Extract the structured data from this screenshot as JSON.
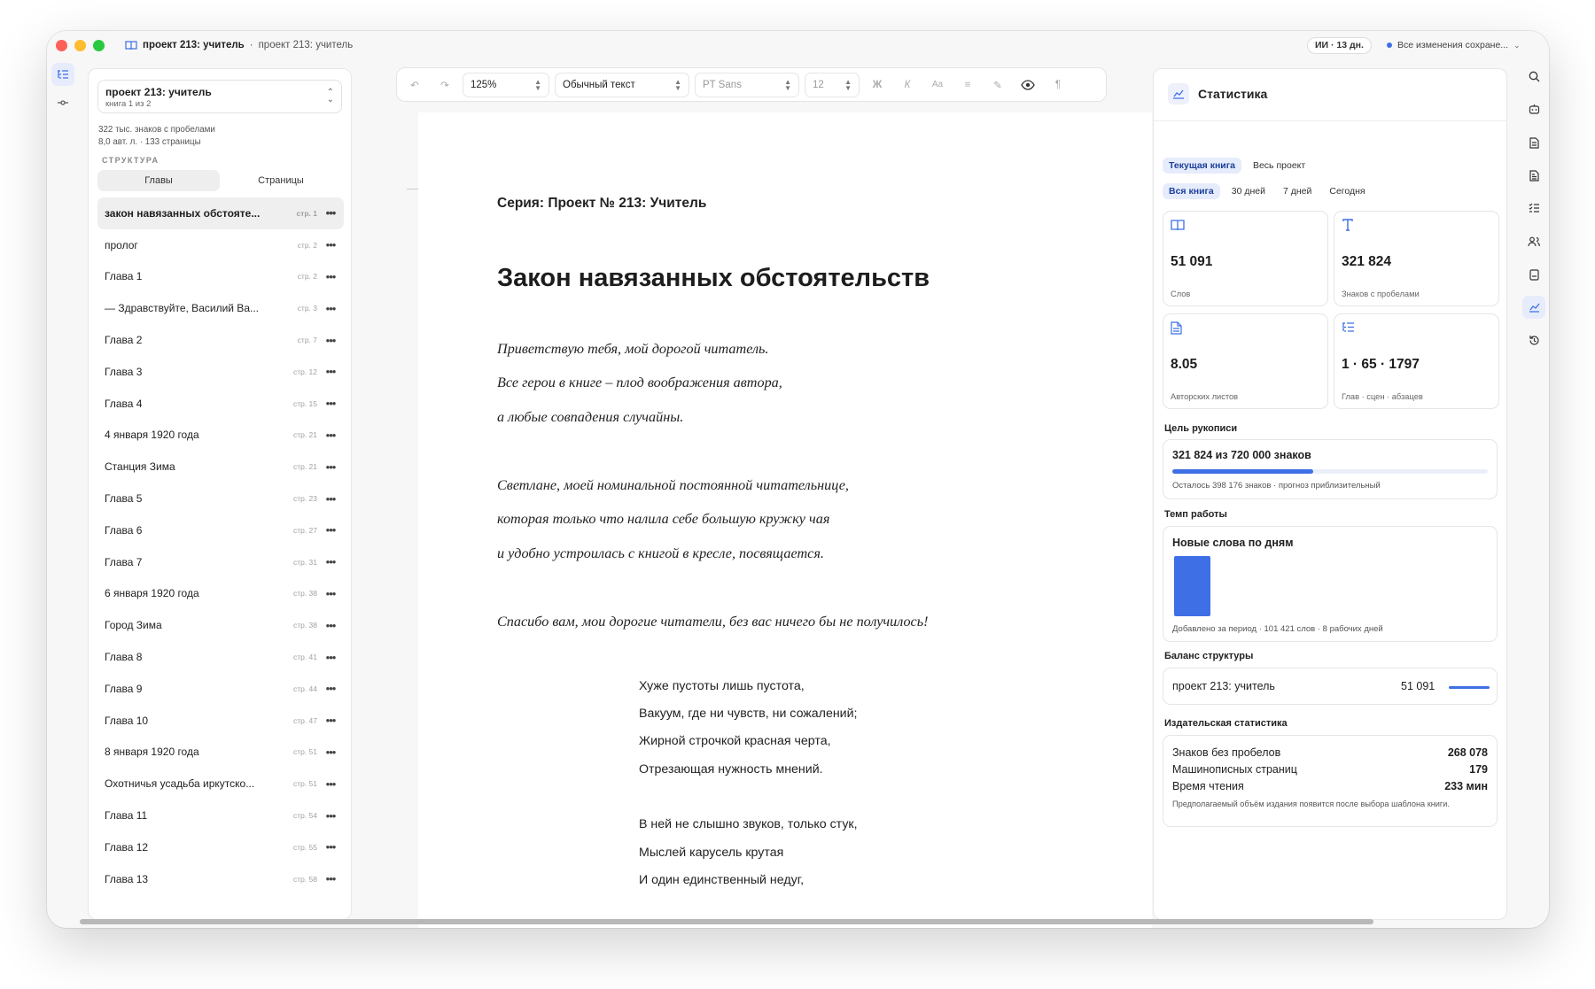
{
  "window": {
    "title_bold": "проект 213: учитель",
    "title_sep": "·",
    "title_sub": "проект 213: учитель",
    "ai_badge": "ИИ · 13 дн.",
    "saved_status": "Все изменения сохране..."
  },
  "sidebar": {
    "project_name": "проект 213: учитель",
    "project_sub": "книга 1 из 2",
    "meta_line1": "322 тыс. знаков с пробелами",
    "meta_line2": "8,0 авт. л. · 133 страницы",
    "structure_label": "СТРУКТУРА",
    "seg_chapters": "Главы",
    "seg_pages": "Страницы",
    "items": [
      {
        "label": "закон навязанных обстояте...",
        "page": "стр. 1"
      },
      {
        "label": "пролог",
        "page": "стр. 2"
      },
      {
        "label": "Глава 1",
        "page": "стр. 2"
      },
      {
        "label": "— Здравствуйте, Василий Ва...",
        "page": "стр. 3"
      },
      {
        "label": "Глава 2",
        "page": "стр. 7"
      },
      {
        "label": "Глава 3",
        "page": "стр. 12"
      },
      {
        "label": "Глава 4",
        "page": "стр. 15"
      },
      {
        "label": "4 января 1920 года",
        "page": "стр. 21"
      },
      {
        "label": "Станция Зима",
        "page": "стр. 21"
      },
      {
        "label": "Глава 5",
        "page": "стр. 23"
      },
      {
        "label": "Глава 6",
        "page": "стр. 27"
      },
      {
        "label": "Глава 7",
        "page": "стр. 31"
      },
      {
        "label": "6 января 1920 года",
        "page": "стр. 38"
      },
      {
        "label": "Город Зима",
        "page": "стр. 38"
      },
      {
        "label": "Глава 8",
        "page": "стр. 41"
      },
      {
        "label": "Глава 9",
        "page": "стр. 44"
      },
      {
        "label": "Глава 10",
        "page": "стр. 47"
      },
      {
        "label": "8 января 1920 года",
        "page": "стр. 51"
      },
      {
        "label": "Охотничья усадьба иркутско...",
        "page": "стр. 51"
      },
      {
        "label": "Глава 11",
        "page": "стр. 54"
      },
      {
        "label": "Глава 12",
        "page": "стр. 55"
      },
      {
        "label": "Глава 13",
        "page": "стр. 58"
      }
    ]
  },
  "toolbar": {
    "zoom": "125%",
    "style": "Обычный текст",
    "font": "PT Sans",
    "size": "12",
    "bold": "Ж",
    "italic": "К",
    "case": "Aa"
  },
  "document": {
    "series": "Серия: Проект № 213: Учитель",
    "title": "Закон навязанных обстоятельств",
    "italic_lines": [
      "Приветствую тебя, мой дорогой читатель.",
      "Все герои в книге – плод воображения автора,",
      "а любые совпадения случайны.",
      "Светлане, моей номинальной постоянной читательнице,",
      "которая только что налила себе большую кружку чая",
      "и удобно устроилась с книгой в кресле, посвящается.",
      "Спасибо вам, мои дорогие читатели, без вас ничего бы не получилось!"
    ],
    "poem_lines": [
      "Хуже пустоты лишь пустота,",
      "Вакуум, где ни чувств, ни сожалений;",
      "Жирной строчкой красная черта,",
      "Отрезающая нужность мнений.",
      "В ней не слышно звуков, только стук,",
      "Мыслей карусель крутая",
      "И один единственный недуг,"
    ]
  },
  "stats": {
    "title": "Статистика",
    "scope_tabs": [
      "Текущая книга",
      "Весь проект"
    ],
    "period_tabs": [
      "Вся книга",
      "30 дней",
      "7 дней",
      "Сегодня"
    ],
    "cards": [
      {
        "icon": "book-icon",
        "value": "51 091",
        "label": "Слов"
      },
      {
        "icon": "text-icon",
        "value": "321 824",
        "label": "Знаков с пробелами"
      },
      {
        "icon": "document-icon",
        "value": "8.05",
        "label": "Авторских листов"
      },
      {
        "icon": "list-icon",
        "value": "1 · 65 · 1797",
        "label": "Глав · сцен · абзацев"
      }
    ],
    "goal_header": "Цель рукописи",
    "goal_value": "321 824 из 720 000 знаков",
    "goal_progress": 0.447,
    "goal_note": "Осталось 398 176 знаков · прогноз приблизительный",
    "tempo_header": "Темп работы",
    "tempo_title": "Новые слова по дням",
    "tempo_note": "Добавлено за период · 101 421 слов · 8 рабочих дней",
    "balance_header": "Баланс структуры",
    "balance_label": "проект 213: учитель",
    "balance_value": "51 091",
    "pub_header": "Издательская статистика",
    "pub_rows": [
      {
        "label": "Знаков без пробелов",
        "value": "268 078"
      },
      {
        "label": "Машинописных страниц",
        "value": "179"
      },
      {
        "label": "Время чтения",
        "value": "233 мин"
      }
    ],
    "pub_note": "Предполагаемый объём издания появится после выбора шаблона книги."
  },
  "colors": {
    "accent": "#3f6fe5",
    "tab_active_bg": "#e6ecfb"
  }
}
